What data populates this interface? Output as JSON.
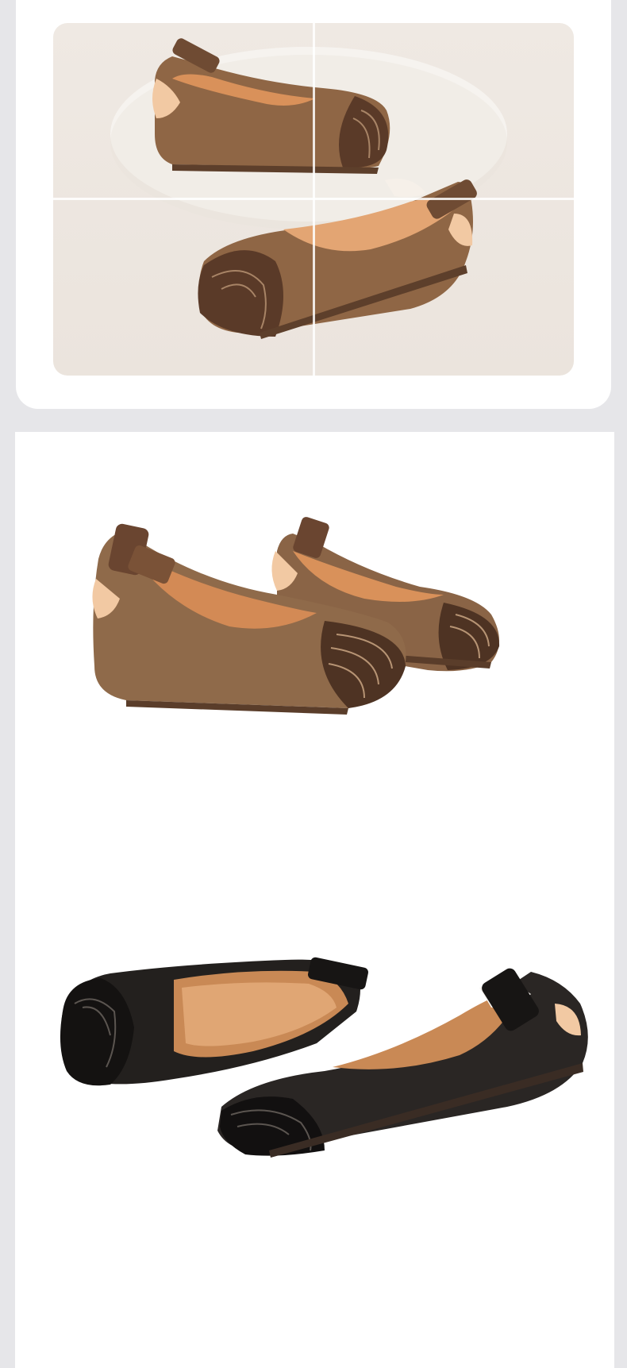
{
  "gallery": {
    "top_image": {
      "alt_icon": "shoe-photo-collage-icon",
      "color": "brown",
      "views": 4
    },
    "brown_pair": {
      "alt_icon": "brown-shoe-pair-photo-icon",
      "color": "brown"
    },
    "black_pair": {
      "alt_icon": "black-shoe-pair-photo-icon",
      "color": "black"
    }
  },
  "colors": {
    "page_bg": "#e6e6e9",
    "card_bg": "#ffffff",
    "brown_leather": "#8a6446",
    "black_leather": "#1f1d1c",
    "lining": "#e0a674"
  }
}
